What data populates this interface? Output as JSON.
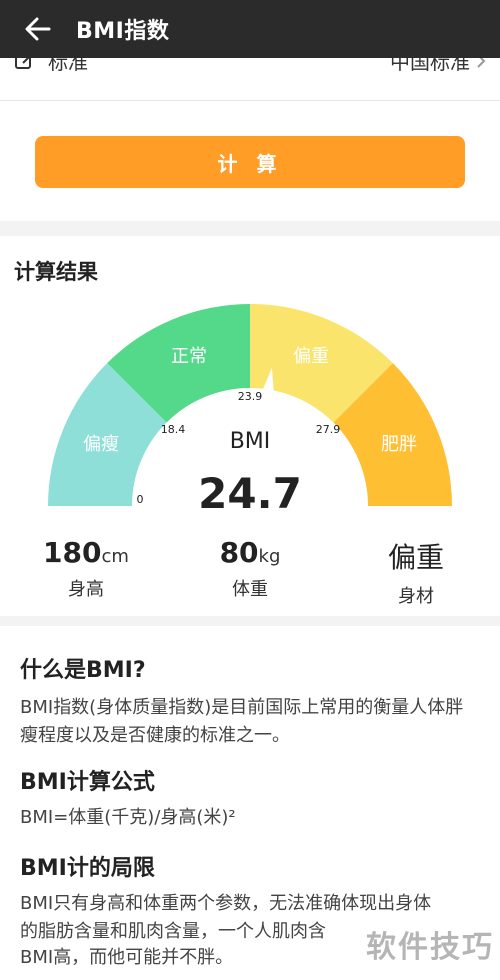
{
  "header": {
    "title": "BMI指数"
  },
  "standard": {
    "label": "标准",
    "value": "中国标准"
  },
  "calc_button": "计 算",
  "result": {
    "title": "计算结果",
    "gauge_min": 0,
    "gauge_max": 40,
    "segments": [
      {
        "label": "偏瘦",
        "from": 0,
        "to": 18.4,
        "color": "#8fdfd9"
      },
      {
        "label": "正常",
        "from": 18.4,
        "to": 23.9,
        "color": "#54d88a"
      },
      {
        "label": "偏重",
        "from": 23.9,
        "to": 27.9,
        "color": "#fbe46c"
      },
      {
        "label": "肥胖",
        "from": 27.9,
        "to": 40,
        "color": "#ffbf32"
      }
    ],
    "ticks": [
      "0",
      "18.4",
      "23.9",
      "27.9"
    ],
    "bmi_label": "BMI",
    "bmi_value": "24.7",
    "height_value": "180",
    "height_unit": "cm",
    "height_label": "身高",
    "weight_value": "80",
    "weight_unit": "kg",
    "weight_label": "体重",
    "figure_value": "偏重",
    "figure_label": "身材"
  },
  "info": {
    "what_title": "什么是BMI?",
    "what_text": "BMI指数(身体质量指数)是目前国际上常用的衡量人体胖瘦程度以及是否健康的标准之一。",
    "formula_title": "BMI计算公式",
    "formula_text": "BMI=体重(千克)/身高(米)²",
    "limit_title": "BMI计的局限",
    "limit_text_1": "BMI只有身高和体重两个参数，无法准确体现出身体",
    "limit_text_2": "的脂肪含量和肌肉含量，一个人肌肉含",
    "limit_text_3": "BMI高，而他可能并不胖。"
  },
  "watermark": "软件技巧"
}
